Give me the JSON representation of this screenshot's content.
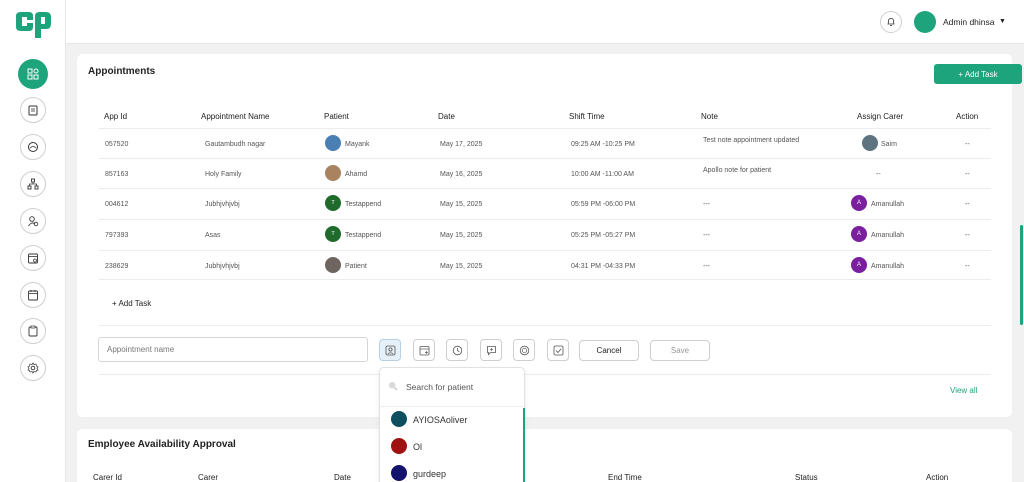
{
  "header": {
    "admin_name": "Admin dhinsa"
  },
  "sidebar": {
    "items": [
      {
        "name": "dashboard-icon"
      },
      {
        "name": "clipboard-icon"
      },
      {
        "name": "circle-icon"
      },
      {
        "name": "org-chart-icon"
      },
      {
        "name": "users-icon"
      },
      {
        "name": "calendar-icon"
      },
      {
        "name": "calendar-alt-icon"
      },
      {
        "name": "document-icon"
      },
      {
        "name": "settings-icon"
      }
    ]
  },
  "appointments": {
    "title": "Appointments",
    "add_task_button": "+ Add Task",
    "columns": [
      "App Id",
      "Appointment Name",
      "Patient",
      "Date",
      "Shift Time",
      "Note",
      "Assign Carer",
      "Action"
    ],
    "rows": [
      {
        "app_id": "057520",
        "name": "Gautambudh nagar",
        "patient": "Mayank",
        "date": "May 17, 2025",
        "shift": "09:25 AM -10:25 PM",
        "note": "Test note appointment updated",
        "carer": "Saim",
        "action": "--"
      },
      {
        "app_id": "857163",
        "name": "Holy Family",
        "patient": "Ahamd",
        "date": "May 16, 2025",
        "shift": "10:00 AM -11:00 AM",
        "note": "Apollo note for patient",
        "carer": "--",
        "action": "--"
      },
      {
        "app_id": "004612",
        "name": "Jubhjvhjvbj",
        "patient": "Testappend",
        "date": "May 15, 2025",
        "shift": "05:59 PM -06:00 PM",
        "note": "---",
        "carer": "Amanullah",
        "action": "--"
      },
      {
        "app_id": "797393",
        "name": "Asas",
        "patient": "Testappend",
        "date": "May 15, 2025",
        "shift": "05:25 PM -05:27 PM",
        "note": "---",
        "carer": "Amanullah",
        "action": "--"
      },
      {
        "app_id": "238629",
        "name": "Jubhjvhjvbj",
        "patient": "Patient",
        "date": "May 15, 2025",
        "shift": "04:31 PM -04:33 PM",
        "note": "---",
        "carer": "Amanullah",
        "action": "--"
      }
    ],
    "add_task_link": "+ Add Task",
    "new_task": {
      "placeholder": "Appointment name",
      "cancel": "Cancel",
      "save": "Save"
    },
    "view_all": "View all"
  },
  "patient_dropdown": {
    "search_placeholder": "Search for patient",
    "items": [
      {
        "name": "AYIOSAoliver",
        "color": "#0e4e5e"
      },
      {
        "name": "Ol",
        "color": "#a01212"
      },
      {
        "name": "gurdeep",
        "color": "#13136e"
      }
    ]
  },
  "employee_availability": {
    "title": "Employee Availability Approval",
    "columns": [
      "Carer Id",
      "Carer",
      "Date",
      "End Time",
      "Status",
      "Action"
    ]
  },
  "colors": {
    "accent": "#1ea47c",
    "carer_avatar": "#7a1f9e",
    "patient_avatar_green": "#1e6b2c"
  }
}
